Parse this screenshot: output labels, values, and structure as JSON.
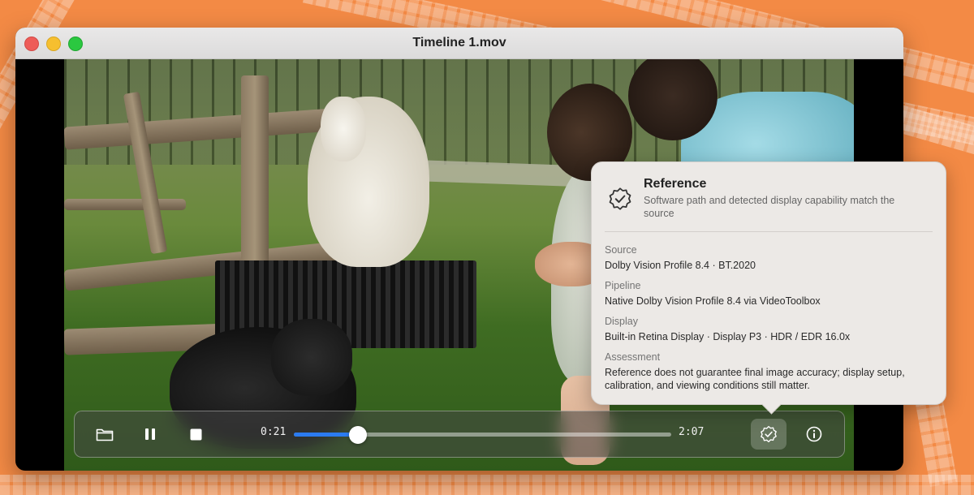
{
  "window": {
    "title": "Timeline 1.mov"
  },
  "player": {
    "current_time": "0:21",
    "duration": "2:07",
    "progress": 0.17,
    "accent_color": "#2b7bf0",
    "icons": {
      "open": "folder-icon",
      "pause": "pause-icon",
      "stop": "stop-icon",
      "reference": "checkmark-seal-icon",
      "info": "info-icon"
    }
  },
  "popover": {
    "title": "Reference",
    "subtitle": "Software path and detected display capability match the source",
    "sections": [
      {
        "label": "Source",
        "value": "Dolby Vision Profile 8.4 · BT.2020"
      },
      {
        "label": "Pipeline",
        "value": "Native Dolby Vision Profile 8.4 via VideoToolbox"
      },
      {
        "label": "Display",
        "value": "Built-in Retina Display · Display P3 · HDR / EDR 16.0x"
      },
      {
        "label": "Assessment",
        "value": "Reference does not guarantee final image accuracy; display setup, calibration, and viewing conditions still matter."
      }
    ]
  }
}
